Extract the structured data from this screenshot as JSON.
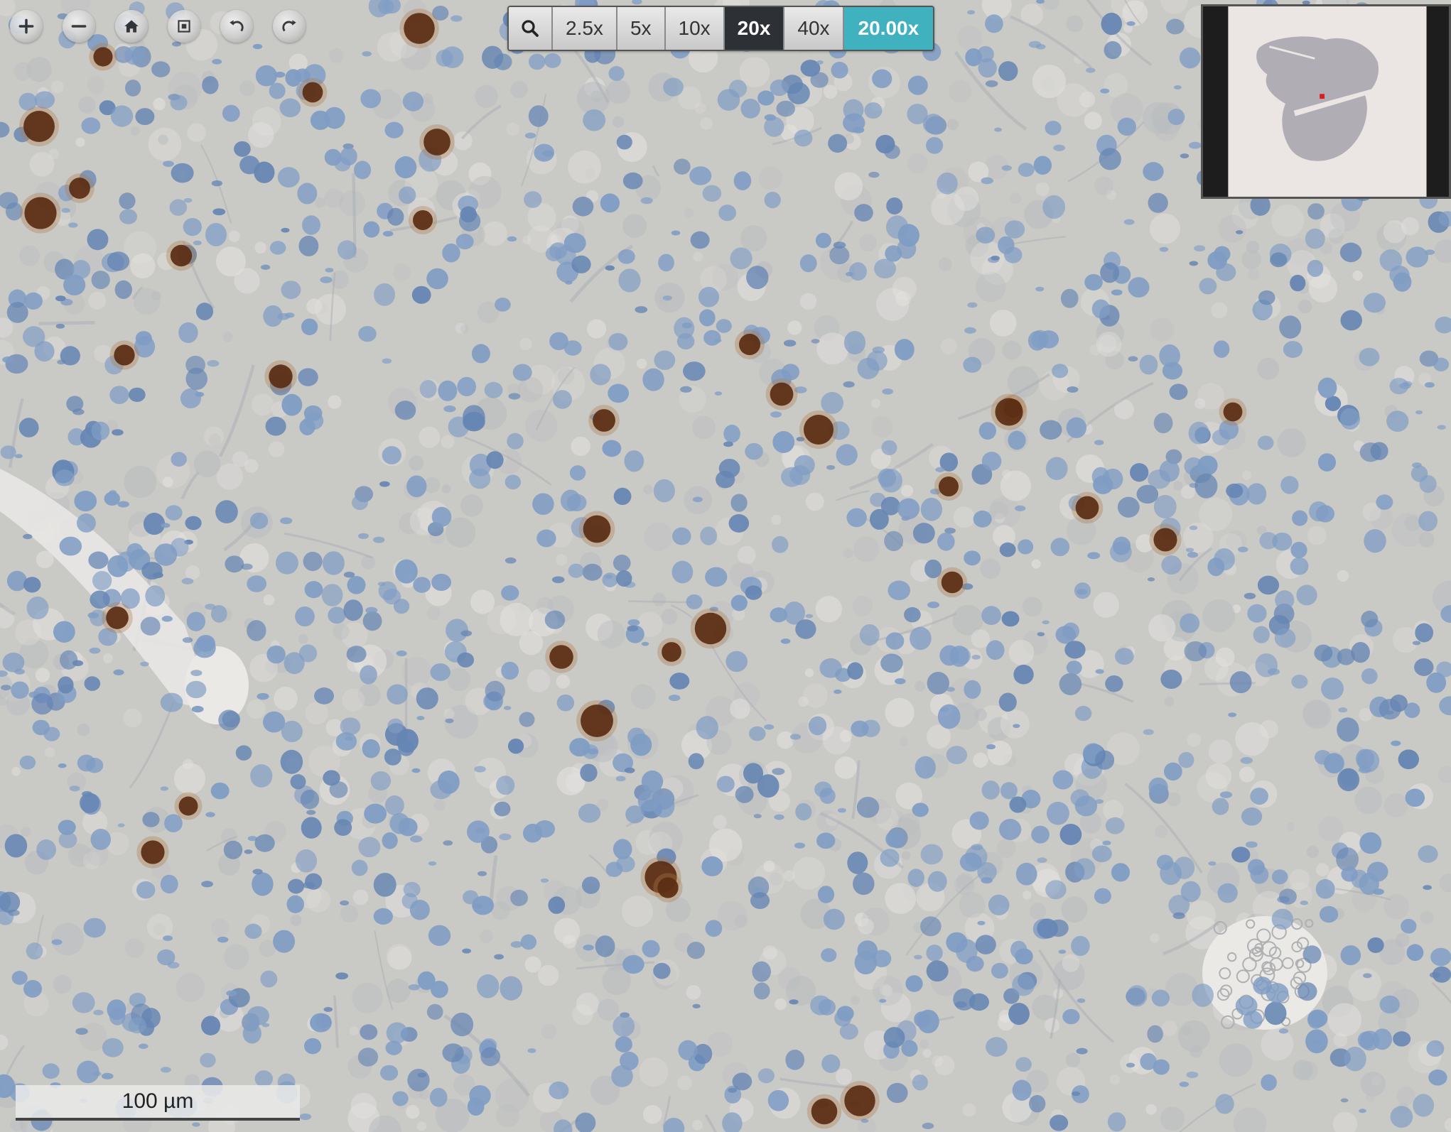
{
  "navigation": {
    "buttons": [
      {
        "name": "zoom-in-button",
        "icon": "plus-icon"
      },
      {
        "name": "zoom-out-button",
        "icon": "minus-icon"
      },
      {
        "name": "home-button",
        "icon": "home-icon"
      },
      {
        "name": "fullscreen-button",
        "icon": "fullscreen-icon"
      },
      {
        "name": "rotate-left-button",
        "icon": "rotate-left-icon"
      },
      {
        "name": "rotate-right-button",
        "icon": "rotate-right-icon"
      }
    ]
  },
  "magnification": {
    "zoom_icon": "magnifier-icon",
    "presets": [
      "2.5x",
      "5x",
      "10x",
      "20x",
      "40x"
    ],
    "selected_preset": "20x",
    "current_zoom": "20.00x"
  },
  "scalebar": {
    "label": "100 µm"
  },
  "colors": {
    "accent": "#3fb1bf",
    "active_preset": "#2d3136",
    "tissue_background": "#c9c9c6",
    "hematoxylin_nuclei": "#7f9cc4",
    "dab_positive_nuclei": "#5a2c12",
    "overview_marker": "#d62020"
  }
}
